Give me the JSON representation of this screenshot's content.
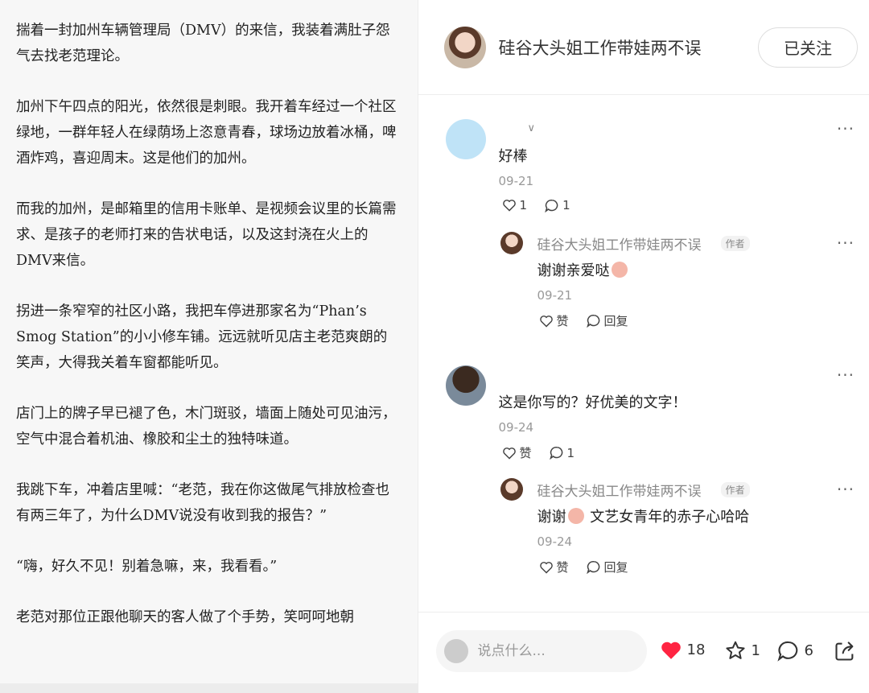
{
  "article": {
    "paragraphs": [
      "揣着一封加州车辆管理局（DMV）的来信，我装着满肚子怨气去找老范理论。",
      "加州下午四点的阳光，依然很是刺眼。我开着车经过一个社区绿地，一群年轻人在绿荫场上恣意青春，球场边放着冰桶，啤酒炸鸡，喜迎周末。这是他们的加州。",
      "而我的加州，是邮箱里的信用卡账单、是视频会议里的长篇需求、是孩子的老师打来的告状电话，以及这封浇在火上的DMV来信。",
      "拐进一条窄窄的社区小路，我把车停进那家名为“Phan’s Smog Station”的小小修车铺。远远就听见店主老范爽朗的笑声，大得我关着车窗都能听见。",
      "店门上的牌子早已褪了色，木门斑驳，墙面上随处可见油污，空气中混合着机油、橡胶和尘土的独特味道。",
      "我跳下车，冲着店里喊：“老范，我在你这做尾气排放检查也有两三年了，为什么DMV说没有收到我的报告？”",
      "“嗨，好久不见！别着急嘛，来，我看看。”",
      "老范对那位正跟他聊天的客人做了个手势，笑呵呵地朝"
    ]
  },
  "header": {
    "author_name": "硅谷大头姐工作带娃两不误",
    "follow_label": "已关注"
  },
  "comments": [
    {
      "name": "∨",
      "text": "好棒",
      "date": "09-21",
      "likes": "1",
      "replies": "1",
      "reply": {
        "name": "硅谷大头姐工作带娃两不误",
        "tag": "作者",
        "text_before": "谢谢亲爱哒",
        "text_after": "",
        "date": "09-21",
        "like_label": "赞",
        "reply_label": "回复"
      }
    },
    {
      "name": "",
      "text": "这是你写的？好优美的文字！",
      "date": "09-24",
      "likes": "赞",
      "replies": "1",
      "reply": {
        "name": "硅谷大头姐工作带娃两不误",
        "tag": "作者",
        "text_before": "谢谢",
        "text_after": " 文艺女青年的赤子心哈哈",
        "date": "09-24",
        "like_label": "赞",
        "reply_label": "回复"
      }
    }
  ],
  "more_label": "···",
  "bottom": {
    "placeholder": "说点什么...",
    "likes": "18",
    "collects": "1",
    "comments": "6"
  },
  "colors": {
    "heart": "#ff2442"
  }
}
